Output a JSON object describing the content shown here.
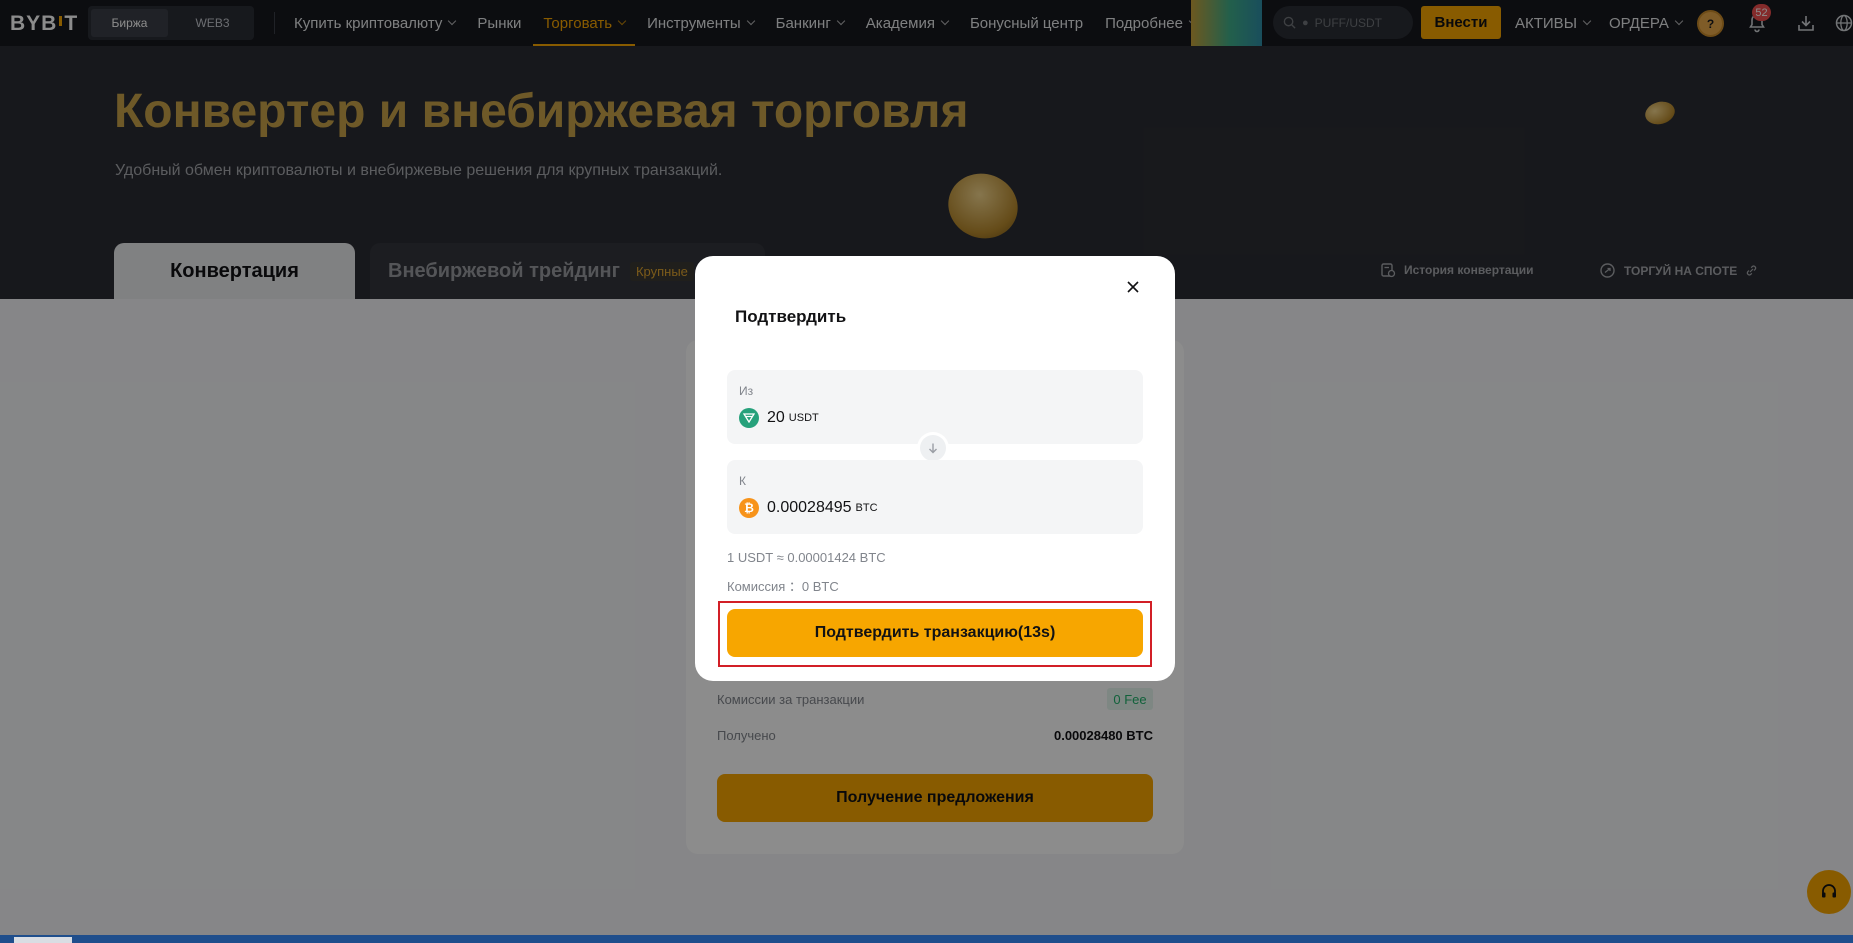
{
  "nav": {
    "logo": "BYB T",
    "segment": [
      "Биржа",
      "WEB3"
    ],
    "menu": [
      {
        "label": "Купить криптовалюту",
        "dropdown": true
      },
      {
        "label": "Рынки",
        "dropdown": false
      },
      {
        "label": "Торговать",
        "dropdown": true,
        "active": true
      },
      {
        "label": "Инструменты",
        "dropdown": true
      },
      {
        "label": "Банкинг",
        "dropdown": true
      },
      {
        "label": "Академия",
        "dropdown": true
      },
      {
        "label": "Бонусный центр",
        "dropdown": false
      },
      {
        "label": "Подробнее",
        "dropdown": true
      }
    ],
    "search_placeholder": "PUFF/USDT",
    "deposit_label": "Внести",
    "assets_label": "АКТИВЫ",
    "orders_label": "ОРДЕРА",
    "notification_count": "52",
    "accent": "#f7a600"
  },
  "hero": {
    "title": "Конвертер и внебиржевая торговля",
    "subtitle": "Удобный обмен криптовалюты и внебиржевые решения для крупных транзакций.",
    "tab_convert": "Конвертация",
    "tab_otc": "Внебиржевой трейдинг",
    "tab_otc_badge": "Крупные",
    "history_link": "История конвертации",
    "spot_link": "ТОРГУЙ НА СПОТЕ"
  },
  "converter_card": {
    "fee_label": "Комиссии за транзакции",
    "fee_value": "0 Fee",
    "received_label": "Получено",
    "received_value": "0.00028480 BTC",
    "quote_button": "Получение предложения"
  },
  "modal": {
    "title": "Подтвердить",
    "from_label": "Из",
    "from_amount": "20",
    "from_currency": "USDT",
    "to_label": "К",
    "to_amount": "0.00028495",
    "to_currency": "BTC",
    "rate": "1 USDT ≈ 0.00001424 BTC",
    "commission": "Комиссия ：0 BTC",
    "confirm_button": "Подтвердить транзакцию(13s)"
  }
}
